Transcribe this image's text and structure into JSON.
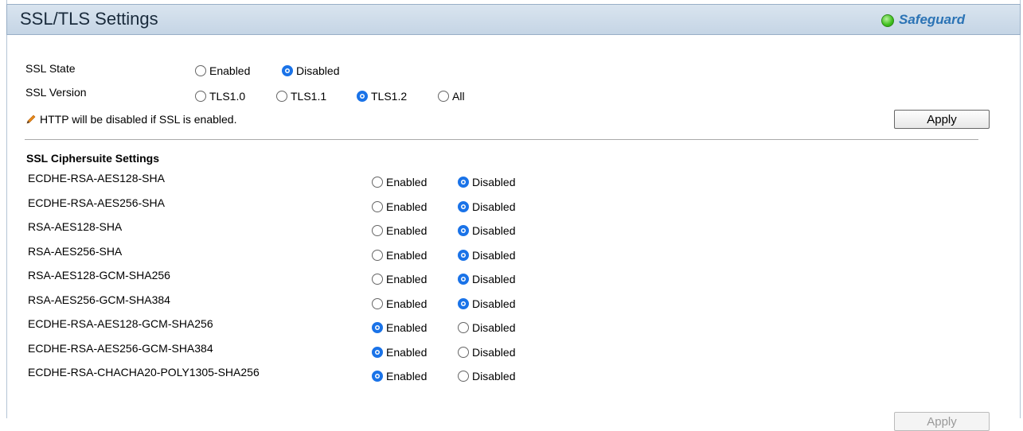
{
  "header": {
    "title": "SSL/TLS Settings",
    "safeguard_label": "Safeguard"
  },
  "ssl_state": {
    "label": "SSL State",
    "options": [
      "Enabled",
      "Disabled"
    ],
    "selected": "Disabled"
  },
  "ssl_version": {
    "label": "SSL Version",
    "options": [
      "TLS1.0",
      "TLS1.1",
      "TLS1.2",
      "All"
    ],
    "selected": "TLS1.2"
  },
  "note": {
    "text": "HTTP will be disabled if SSL is enabled.",
    "icon": "pencil-icon"
  },
  "apply_top": {
    "label": "Apply"
  },
  "ciphersuite": {
    "title": "SSL Ciphersuite Settings",
    "option_enabled": "Enabled",
    "option_disabled": "Disabled",
    "rows": [
      {
        "name": "ECDHE-RSA-AES128-SHA",
        "selected": "Disabled"
      },
      {
        "name": "ECDHE-RSA-AES256-SHA",
        "selected": "Disabled"
      },
      {
        "name": "RSA-AES128-SHA",
        "selected": "Disabled"
      },
      {
        "name": "RSA-AES256-SHA",
        "selected": "Disabled"
      },
      {
        "name": "RSA-AES128-GCM-SHA256",
        "selected": "Disabled"
      },
      {
        "name": "RSA-AES256-GCM-SHA384",
        "selected": "Disabled"
      },
      {
        "name": "ECDHE-RSA-AES128-GCM-SHA256",
        "selected": "Enabled"
      },
      {
        "name": "ECDHE-RSA-AES256-GCM-SHA384",
        "selected": "Enabled"
      },
      {
        "name": "ECDHE-RSA-CHACHA20-POLY1305-SHA256",
        "selected": "Enabled"
      }
    ]
  },
  "apply_bottom": {
    "label": "Apply",
    "disabled": true
  },
  "colors": {
    "accent": "#1a73e8",
    "safeguard": "#2b73b5",
    "status_dot": "#3dbf1c"
  }
}
